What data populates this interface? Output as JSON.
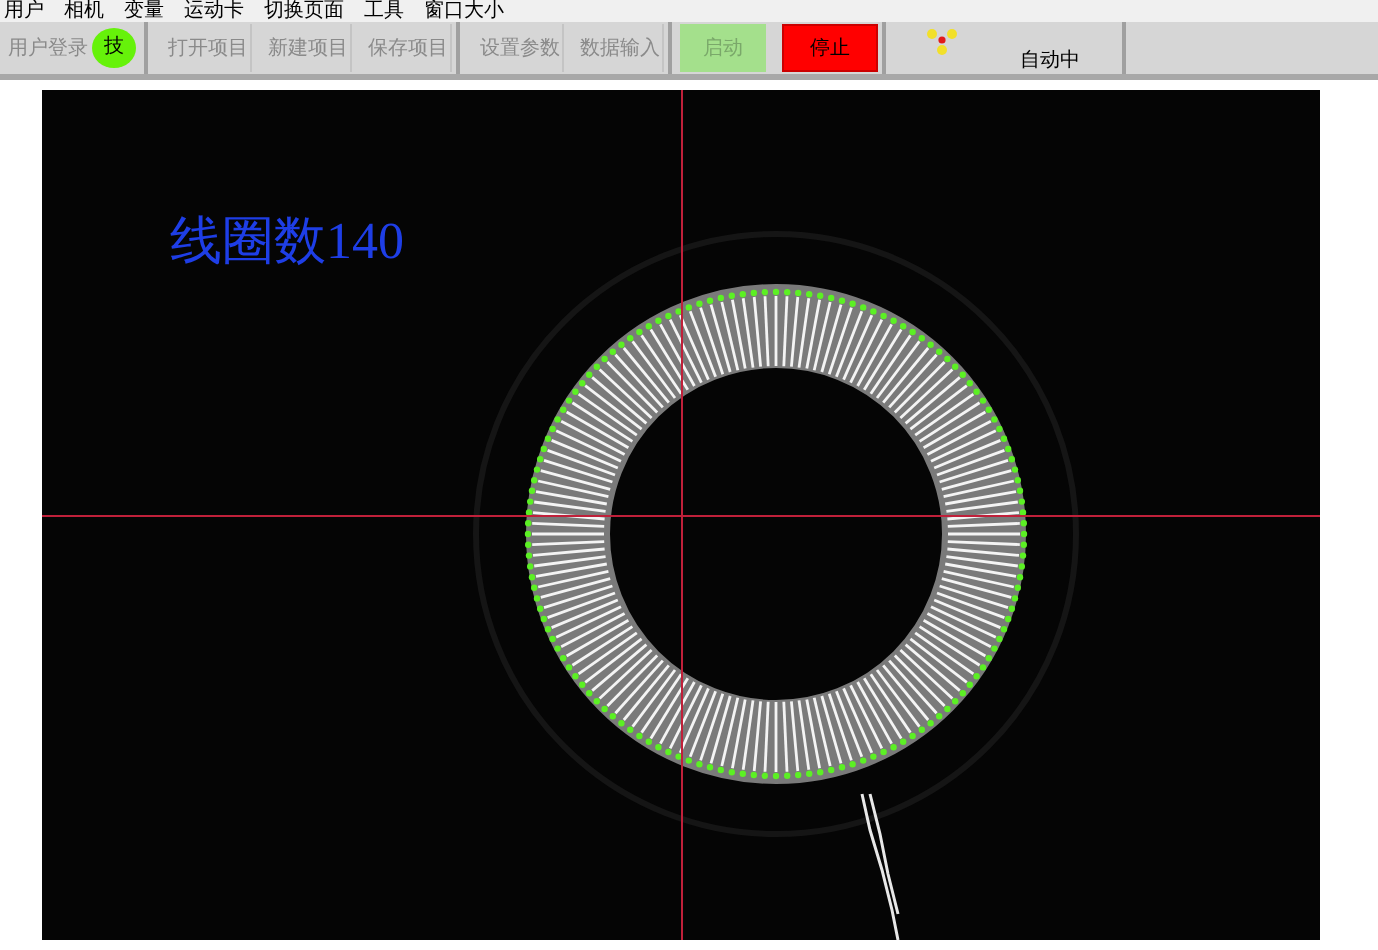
{
  "menu": [
    {
      "label": "用户"
    },
    {
      "label": "相机"
    },
    {
      "label": "变量"
    },
    {
      "label": "运动卡"
    },
    {
      "label": "切换页面"
    },
    {
      "label": "工具"
    },
    {
      "label": "窗口大小"
    }
  ],
  "toolbar": {
    "groups": [
      [
        {
          "label": "用户登录",
          "kind": "plain",
          "badge": "技"
        }
      ],
      [
        {
          "label": "打开项目",
          "kind": "plain"
        },
        {
          "label": "新建项目",
          "kind": "plain"
        },
        {
          "label": "保存项目",
          "kind": "plain"
        }
      ],
      [
        {
          "label": "设置参数",
          "kind": "plain"
        },
        {
          "label": "数据输入",
          "kind": "plain"
        }
      ],
      [
        {
          "label": "启动",
          "kind": "start"
        },
        {
          "label": "停止",
          "kind": "stop"
        }
      ]
    ],
    "status": "自动中"
  },
  "viewer": {
    "overlay_text": "线圈数140"
  }
}
